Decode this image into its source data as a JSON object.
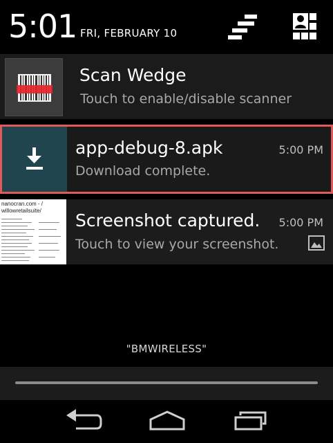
{
  "status": {
    "time": "5:01",
    "date": "FRI, FEBRUARY 10"
  },
  "icons": {
    "clear": "clear-all-icon",
    "settings": "quick-settings-icon",
    "scan": "barcode-scanner-icon",
    "download": "download-icon",
    "image": "image-icon",
    "back": "back-icon",
    "home": "home-icon",
    "recents": "recents-icon"
  },
  "notifications": [
    {
      "title": "Scan Wedge",
      "subtitle": "Touch to enable/disable scanner",
      "time": ""
    },
    {
      "title": "app-debug-8.apk",
      "subtitle": "Download complete.",
      "time": "5:00 PM"
    },
    {
      "title": "Screenshot captured.",
      "subtitle": "Touch to view your screenshot.",
      "time": "5:00 PM"
    }
  ],
  "thumbnail": {
    "line1": "nanocran.com - /",
    "line2": "willowretailsuite/"
  },
  "network": "\"BMWIRELESS\"",
  "colors": {
    "highlight": "#e05a5a",
    "download_icon_bg": "#21454f"
  }
}
